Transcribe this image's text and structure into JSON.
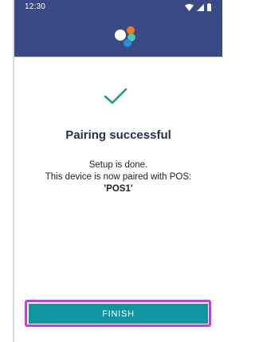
{
  "status_bar": {
    "time": "12:30"
  },
  "pairing": {
    "title": "Pairing successful",
    "setup_text": "Setup is done.",
    "device_text": "This device is now paired with POS:",
    "pos_name": "'POS1'"
  },
  "actions": {
    "finish_label": "FINISH"
  },
  "colors": {
    "primary": "#3b4a84",
    "check": "#1f9e82",
    "button": "#0f95a0",
    "highlight": "#c23de8"
  },
  "icons": [
    "wifi-icon",
    "signal-icon",
    "battery-icon",
    "app-logo",
    "check-icon"
  ]
}
